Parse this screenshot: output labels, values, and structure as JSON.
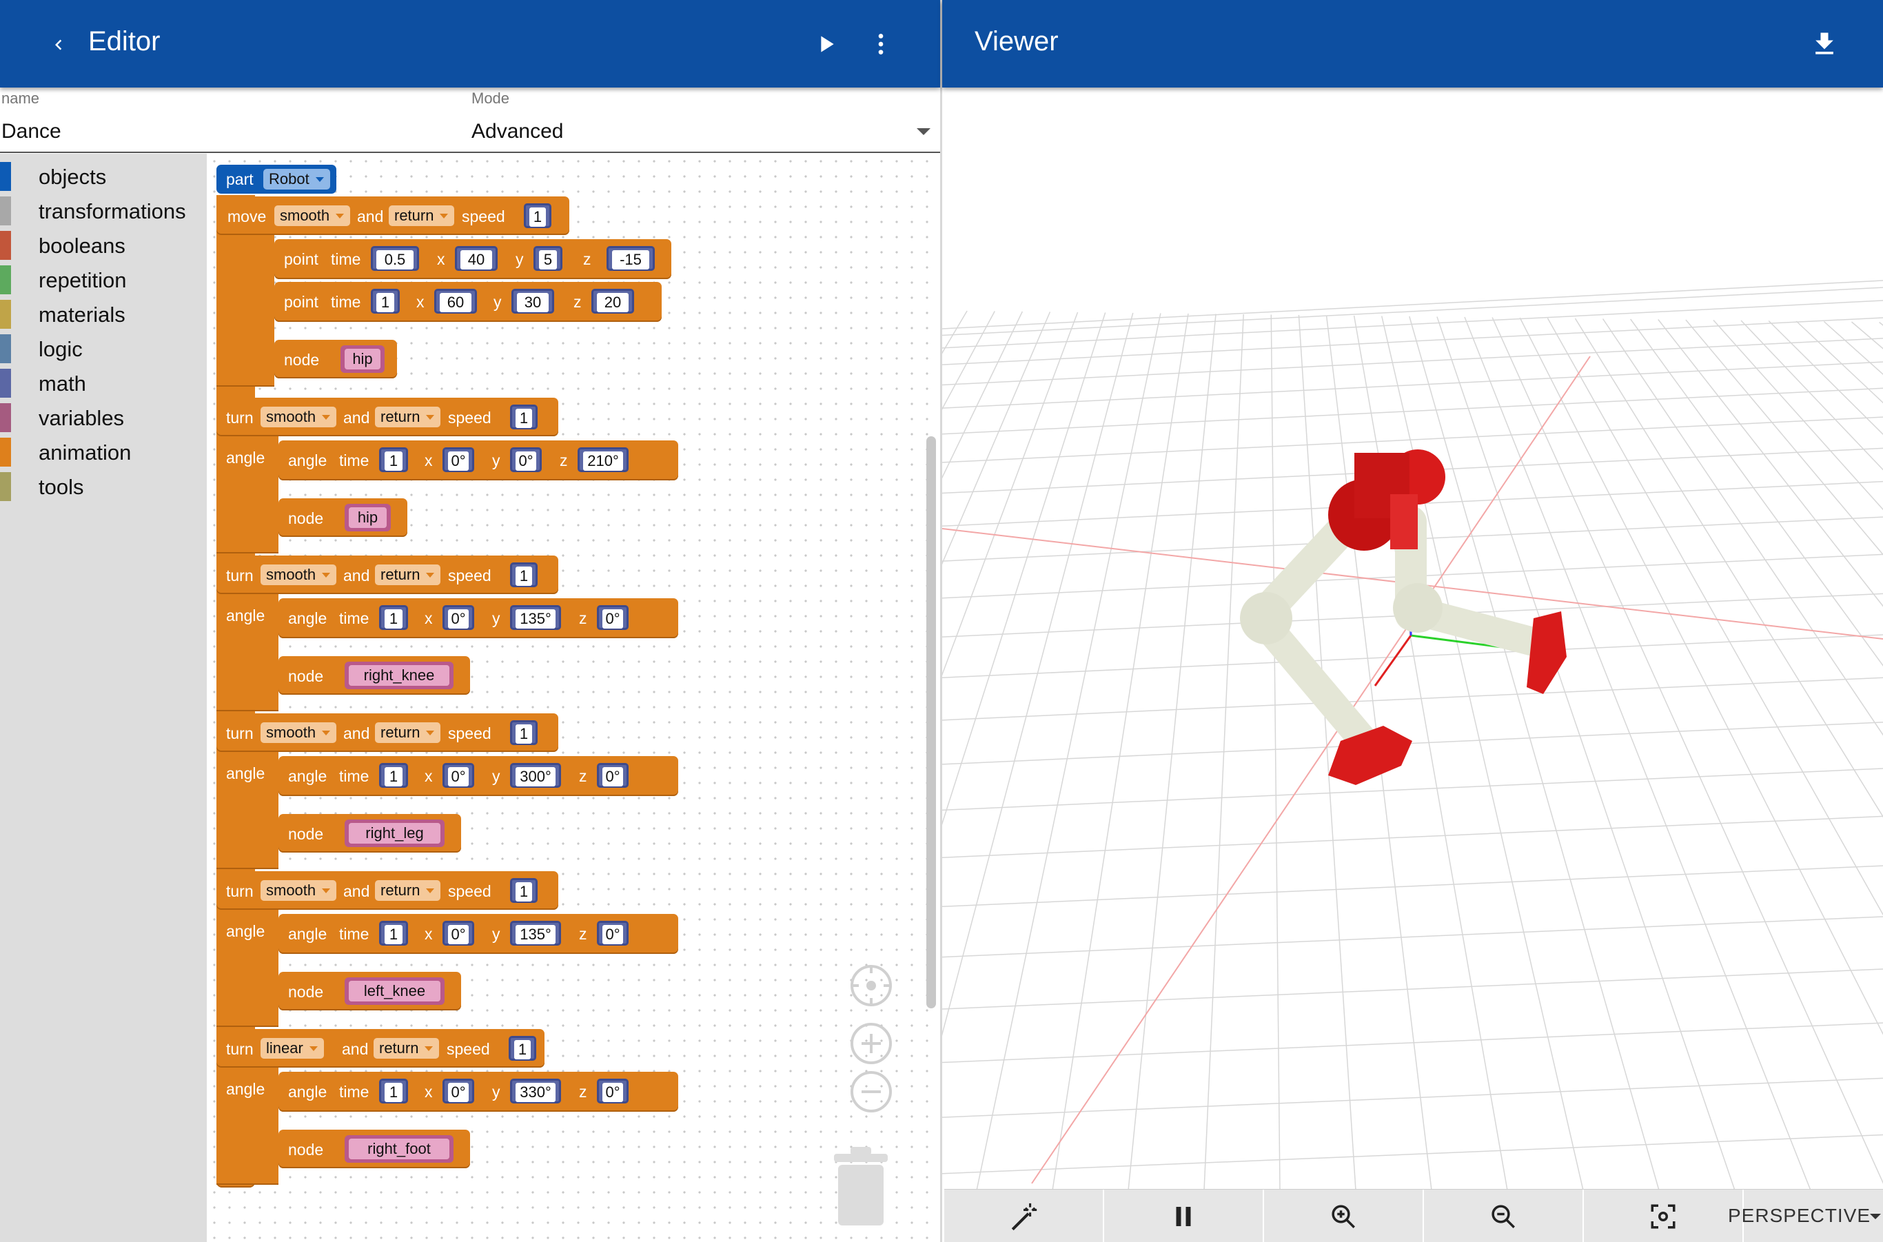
{
  "editor": {
    "title": "Editor",
    "name_label": "name",
    "name_value": "Dance",
    "mode_label": "Mode",
    "mode_value": "Advanced"
  },
  "viewer": {
    "title": "Viewer",
    "projection": "PERSPECTIVE"
  },
  "toolbox": [
    {
      "label": "objects",
      "color": "#0d5bb5"
    },
    {
      "label": "transformations",
      "color": "#a8a8a8"
    },
    {
      "label": "booleans",
      "color": "#c2563a"
    },
    {
      "label": "repetition",
      "color": "#5daa5e"
    },
    {
      "label": "materials",
      "color": "#c0a448"
    },
    {
      "label": "logic",
      "color": "#5b80a5"
    },
    {
      "label": "math",
      "color": "#5b67a5"
    },
    {
      "label": "variables",
      "color": "#a55b80"
    },
    {
      "label": "animation",
      "color": "#de801c"
    },
    {
      "label": "tools",
      "color": "#a5a060"
    }
  ],
  "blocks": {
    "part": {
      "keyword": "part",
      "value": "Robot"
    },
    "move": {
      "keyword": "move",
      "easing": "smooth",
      "and": "and",
      "mode": "return",
      "speed_label": "speed",
      "speed": "1",
      "input_label": "point",
      "points": [
        {
          "keyword": "point",
          "time_label": "time",
          "time": "0.5",
          "x": "40",
          "y": "5",
          "z": "-15"
        },
        {
          "keyword": "point",
          "time_label": "time",
          "time": "1",
          "x": "60",
          "y": "30",
          "z": "20"
        }
      ],
      "node_label": "node",
      "node": "hip"
    },
    "turns": [
      {
        "keyword": "turn",
        "easing": "smooth",
        "and": "and",
        "mode": "return",
        "speed_label": "speed",
        "speed": "1",
        "input_label": "angle",
        "angle_kw": "angle",
        "time_label": "time",
        "time": "1",
        "x": "0°",
        "y": "0°",
        "z": "210°",
        "node_label": "node",
        "node": "hip"
      },
      {
        "keyword": "turn",
        "easing": "smooth",
        "and": "and",
        "mode": "return",
        "speed_label": "speed",
        "speed": "1",
        "input_label": "angle",
        "angle_kw": "angle",
        "time_label": "time",
        "time": "1",
        "x": "0°",
        "y": "135°",
        "z": "0°",
        "node_label": "node",
        "node": "right_knee"
      },
      {
        "keyword": "turn",
        "easing": "smooth",
        "and": "and",
        "mode": "return",
        "speed_label": "speed",
        "speed": "1",
        "input_label": "angle",
        "angle_kw": "angle",
        "time_label": "time",
        "time": "1",
        "x": "0°",
        "y": "300°",
        "z": "0°",
        "node_label": "node",
        "node": "right_leg"
      },
      {
        "keyword": "turn",
        "easing": "smooth",
        "and": "and",
        "mode": "return",
        "speed_label": "speed",
        "speed": "1",
        "input_label": "angle",
        "angle_kw": "angle",
        "time_label": "time",
        "time": "1",
        "x": "0°",
        "y": "135°",
        "z": "0°",
        "node_label": "node",
        "node": "left_knee"
      },
      {
        "keyword": "turn",
        "easing": "linear",
        "and": "and",
        "mode": "return",
        "speed_label": "speed",
        "speed": "1",
        "input_label": "angle",
        "angle_kw": "angle",
        "time_label": "time",
        "time": "1",
        "x": "0°",
        "y": "330°",
        "z": "0°",
        "node_label": "node",
        "node": "right_foot"
      }
    ],
    "axis_labels": {
      "x": "x",
      "y": "y",
      "z": "z"
    }
  }
}
